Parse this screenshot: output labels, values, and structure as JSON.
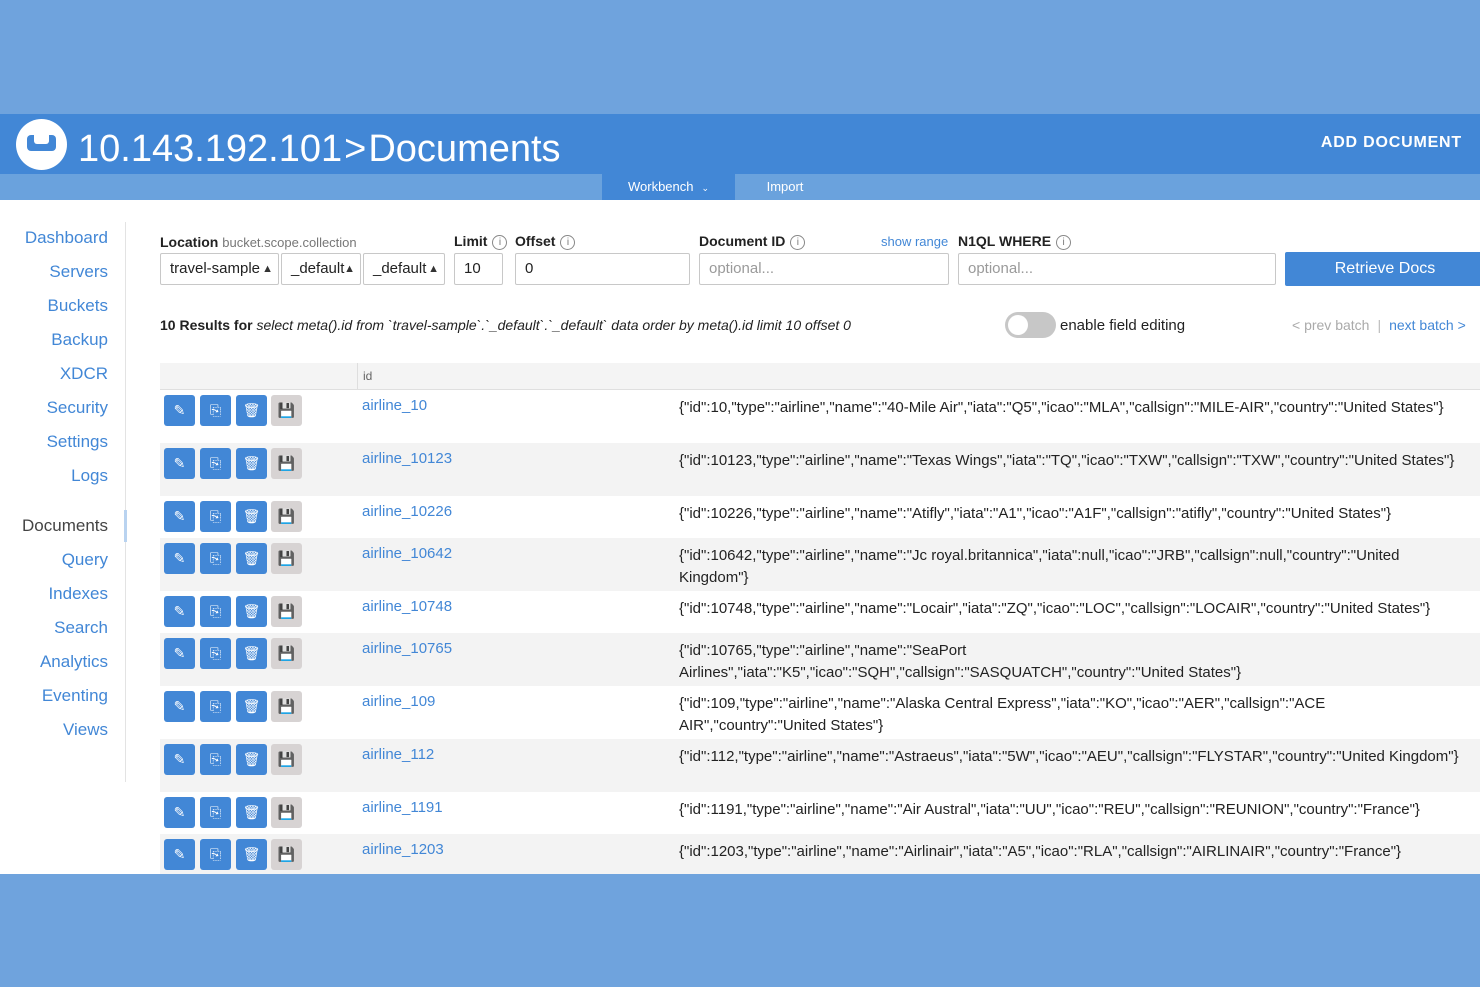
{
  "header": {
    "host": "10.143.192.101",
    "separator": ">",
    "section": "Documents",
    "add_document": "ADD DOCUMENT",
    "tabs": [
      {
        "label": "Workbench",
        "active": true
      },
      {
        "label": "Import",
        "active": false
      }
    ]
  },
  "sidebar": {
    "items": [
      {
        "label": "Dashboard"
      },
      {
        "label": "Servers"
      },
      {
        "label": "Buckets"
      },
      {
        "label": "Backup"
      },
      {
        "label": "XDCR"
      },
      {
        "label": "Security"
      },
      {
        "label": "Settings"
      },
      {
        "label": "Logs"
      },
      {
        "label": "Documents"
      },
      {
        "label": "Query"
      },
      {
        "label": "Indexes"
      },
      {
        "label": "Search"
      },
      {
        "label": "Analytics"
      },
      {
        "label": "Eventing"
      },
      {
        "label": "Views"
      }
    ]
  },
  "filters": {
    "location_label": "Location",
    "location_hint": "bucket.scope.collection",
    "bucket": "travel-sample",
    "scope": "_default",
    "collection": "_default",
    "limit_label": "Limit",
    "limit": "10",
    "offset_label": "Offset",
    "offset": "0",
    "docid_label": "Document ID",
    "docid_placeholder": "optional...",
    "show_range": "show range",
    "where_label": "N1QL WHERE",
    "where_placeholder": "optional...",
    "retrieve": "Retrieve Docs",
    "info_glyph": "i"
  },
  "results": {
    "count_text": "10 Results for",
    "query": "select meta().id from `travel-sample`.`_default`.`_default` data order by meta().id limit 10 offset 0",
    "toggle_label": "enable field editing",
    "prev": "< prev batch",
    "sep": "|",
    "next": "next batch >"
  },
  "table": {
    "id_header": "id",
    "rows": [
      {
        "id": "airline_10",
        "json": "{\"id\":10,\"type\":\"airline\",\"name\":\"40-Mile Air\",\"iata\":\"Q5\",\"icao\":\"MLA\",\"callsign\":\"MILE-AIR\",\"country\":\"United States\"}"
      },
      {
        "id": "airline_10123",
        "json": "{\"id\":10123,\"type\":\"airline\",\"name\":\"Texas Wings\",\"iata\":\"TQ\",\"icao\":\"TXW\",\"callsign\":\"TXW\",\"country\":\"United States\"}"
      },
      {
        "id": "airline_10226",
        "json": "{\"id\":10226,\"type\":\"airline\",\"name\":\"Atifly\",\"iata\":\"A1\",\"icao\":\"A1F\",\"callsign\":\"atifly\",\"country\":\"United States\"}"
      },
      {
        "id": "airline_10642",
        "json": "{\"id\":10642,\"type\":\"airline\",\"name\":\"Jc royal.britannica\",\"iata\":null,\"icao\":\"JRB\",\"callsign\":null,\"country\":\"United Kingdom\"}"
      },
      {
        "id": "airline_10748",
        "json": "{\"id\":10748,\"type\":\"airline\",\"name\":\"Locair\",\"iata\":\"ZQ\",\"icao\":\"LOC\",\"callsign\":\"LOCAIR\",\"country\":\"United States\"}"
      },
      {
        "id": "airline_10765",
        "json": "{\"id\":10765,\"type\":\"airline\",\"name\":\"SeaPort Airlines\",\"iata\":\"K5\",\"icao\":\"SQH\",\"callsign\":\"SASQUATCH\",\"country\":\"United States\"}"
      },
      {
        "id": "airline_109",
        "json": "{\"id\":109,\"type\":\"airline\",\"name\":\"Alaska Central Express\",\"iata\":\"KO\",\"icao\":\"AER\",\"callsign\":\"ACE AIR\",\"country\":\"United States\"}"
      },
      {
        "id": "airline_112",
        "json": "{\"id\":112,\"type\":\"airline\",\"name\":\"Astraeus\",\"iata\":\"5W\",\"icao\":\"AEU\",\"callsign\":\"FLYSTAR\",\"country\":\"United Kingdom\"}"
      },
      {
        "id": "airline_1191",
        "json": "{\"id\":1191,\"type\":\"airline\",\"name\":\"Air Austral\",\"iata\":\"UU\",\"icao\":\"REU\",\"callsign\":\"REUNION\",\"country\":\"France\"}"
      },
      {
        "id": "airline_1203",
        "json": "{\"id\":1203,\"type\":\"airline\",\"name\":\"Airlinair\",\"iata\":\"A5\",\"icao\":\"RLA\",\"callsign\":\"AIRLINAIR\",\"country\":\"France\"}"
      }
    ]
  },
  "icons": {
    "edit": "pencil-icon",
    "copy": "copy-icon",
    "delete": "trash-icon",
    "save": "save-icon"
  },
  "colors": {
    "brand_blue": "#4287d6",
    "background": "#6fa3dd"
  }
}
